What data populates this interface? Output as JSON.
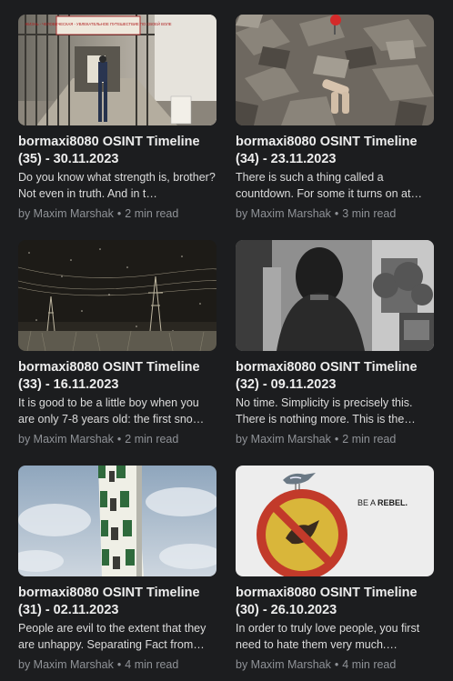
{
  "posts": [
    {
      "title": "bormaxi8080 OSINT Timeline (35) - 30.11.2023",
      "excerpt": "Do you know what strength is, brother? Not even in truth. And in t…",
      "author": "by Maxim Marshak",
      "read_time": "2 min read",
      "image": "prison-corridor-image",
      "sign_text": "ЖИЗНЬ - ЧЕЛОВЕЧЕСКАЯ - УВЛЕКАТЕЛЬНОЕ ПУТЕШЕСТВИЕ ПО СВОЕЙ ВОЛЕ"
    },
    {
      "title": "bormaxi8080 OSINT Timeline (34) - 23.11.2023",
      "excerpt": "There is such a thing called a countdown. For some it turns on at…",
      "author": "by Maxim Marshak",
      "read_time": "3 min read",
      "image": "rubble-doll-image"
    },
    {
      "title": "bormaxi8080 OSINT Timeline (33) - 16.11.2023",
      "excerpt": "It is good to be a little boy when you are only 7-8 years old: the first sno…",
      "author": "by Maxim Marshak",
      "read_time": "2 min read",
      "image": "snowy-powerlines-image"
    },
    {
      "title": "bormaxi8080 OSINT Timeline (32) - 09.11.2023",
      "excerpt": "No time. Simplicity is precisely this. There is nothing more. This is the…",
      "author": "by Maxim Marshak",
      "read_time": "2 min read",
      "image": "woman-window-image"
    },
    {
      "title": "bormaxi8080 OSINT Timeline (31) - 02.11.2023",
      "excerpt": "People are evil to the extent that they are unhappy. Separating Fact from…",
      "author": "by Maxim Marshak",
      "read_time": "4 min read",
      "image": "tower-sky-image"
    },
    {
      "title": "bormaxi8080 OSINT Timeline (30) - 26.10.2023",
      "excerpt": "In order to truly love people, you first need to hate them very much.…",
      "author": "by Maxim Marshak",
      "read_time": "4 min read",
      "image": "be-a-rebel-sign-image",
      "overlay_prefix": "BE A ",
      "overlay_bold": "REBEL."
    }
  ]
}
